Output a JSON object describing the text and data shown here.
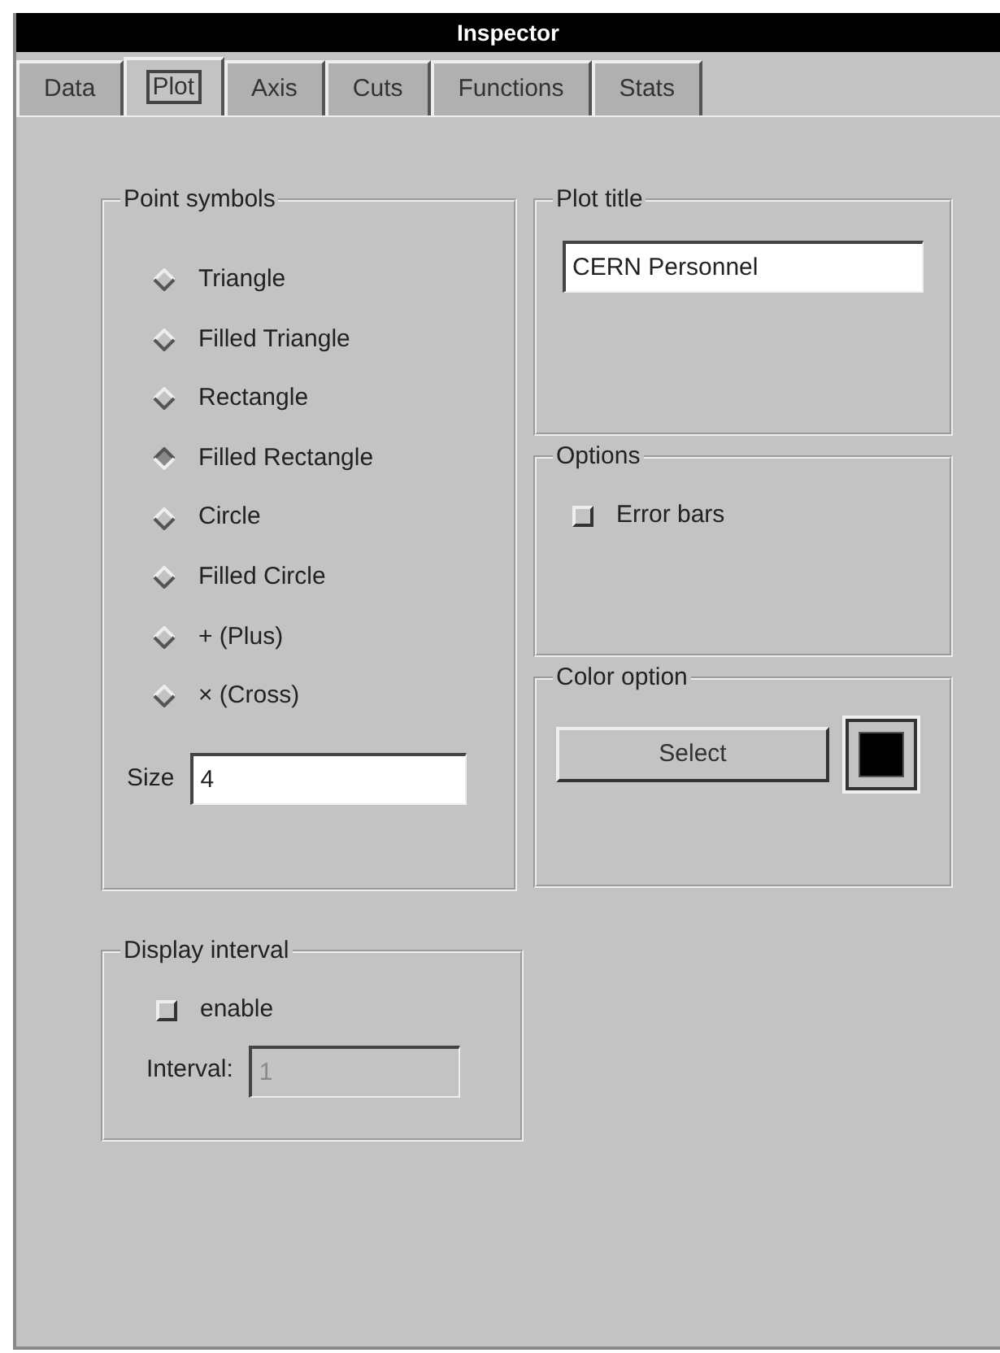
{
  "window": {
    "title": "Inspector"
  },
  "tabs": [
    {
      "label": "Data",
      "selected": false
    },
    {
      "label": "Plot",
      "selected": true
    },
    {
      "label": "Axis",
      "selected": false
    },
    {
      "label": "Cuts",
      "selected": false
    },
    {
      "label": "Functions",
      "selected": false
    },
    {
      "label": "Stats",
      "selected": false
    }
  ],
  "point_symbols": {
    "title": "Point symbols",
    "options": [
      {
        "label": "Triangle",
        "selected": false
      },
      {
        "label": "Filled Triangle",
        "selected": false
      },
      {
        "label": "Rectangle",
        "selected": false
      },
      {
        "label": "Filled Rectangle",
        "selected": true
      },
      {
        "label": "Circle",
        "selected": false
      },
      {
        "label": "Filled Circle",
        "selected": false
      },
      {
        "label": "+ (Plus)",
        "selected": false
      },
      {
        "label": "× (Cross)",
        "selected": false
      }
    ],
    "size": {
      "label": "Size",
      "value": "4"
    }
  },
  "plot_title": {
    "title": "Plot title",
    "value": "CERN Personnel"
  },
  "options": {
    "title": "Options",
    "items": [
      {
        "label": "Error bars",
        "checked": false
      }
    ]
  },
  "color_option": {
    "title": "Color option",
    "button": "Select",
    "color": "#000000"
  },
  "display_interval": {
    "title": "Display interval",
    "enable": {
      "label": "enable",
      "checked": false
    },
    "interval": {
      "label": "Interval:",
      "value": "1",
      "disabled": true
    }
  }
}
